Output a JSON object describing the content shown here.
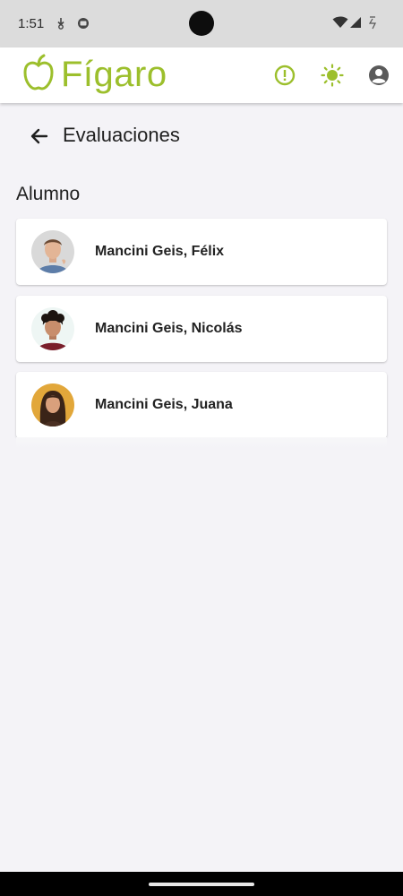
{
  "status_bar": {
    "time": "1:51"
  },
  "app_bar": {
    "logo_text": "Fígaro",
    "brand_color": "#9cbf2c",
    "actions": [
      "alert-icon",
      "theme-sun-icon",
      "account-icon"
    ]
  },
  "page": {
    "title": "Evaluaciones",
    "section_label": "Alumno"
  },
  "students": [
    {
      "name": "Mancini Geis, Félix"
    },
    {
      "name": "Mancini Geis, Nicolás"
    },
    {
      "name": "Mancini Geis, Juana"
    }
  ]
}
